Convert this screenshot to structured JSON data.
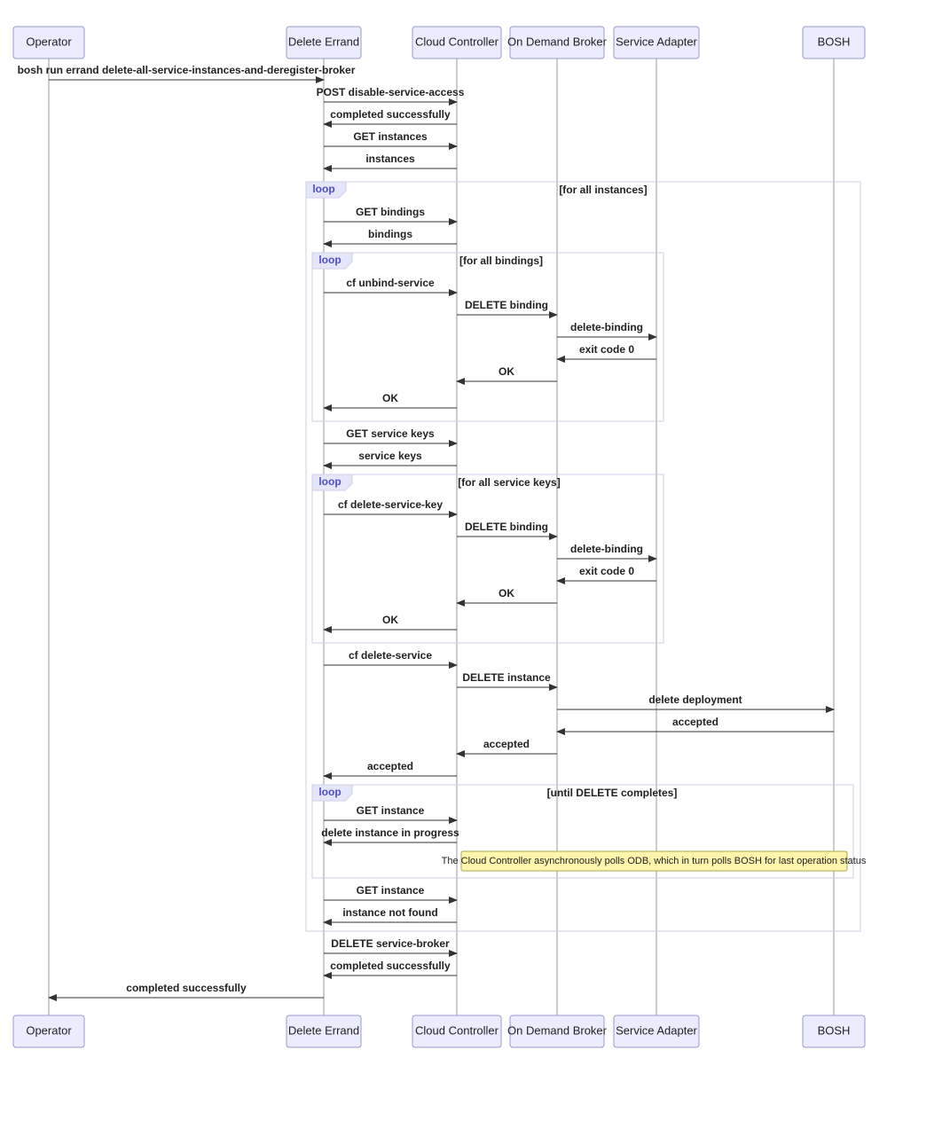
{
  "actors": {
    "operator": "Operator",
    "delete_errand": "Delete Errand",
    "cloud_controller": "Cloud Controller",
    "on_demand_broker": "On Demand Broker",
    "service_adapter": "Service Adapter",
    "bosh": "BOSH"
  },
  "loop_label": "loop",
  "conditions": {
    "all_instances": "[for all instances]",
    "all_bindings": "[for all bindings]",
    "all_service_keys": "[for all service keys]",
    "until_delete": "[until DELETE completes]"
  },
  "messages": {
    "m1": "bosh run errand delete-all-service-instances-and-deregister-broker",
    "m2": "POST disable-service-access",
    "m3": "completed successfully",
    "m4": "GET instances",
    "m5": "instances",
    "m6": "GET bindings",
    "m7": "bindings",
    "m8": "cf unbind-service",
    "m9": "DELETE binding",
    "m10": "delete-binding",
    "m11": "exit code 0",
    "m12": "OK",
    "m13": "OK",
    "m14": "GET service keys",
    "m15": "service keys",
    "m16": "cf delete-service-key",
    "m17": "DELETE binding",
    "m18": "delete-binding",
    "m19": "exit code 0",
    "m20": "OK",
    "m21": "OK",
    "m22": "cf delete-service",
    "m23": "DELETE instance",
    "m24": "delete deployment",
    "m25": "accepted",
    "m26": "accepted",
    "m27": "accepted",
    "m28": "GET instance",
    "m29": "delete instance in progress",
    "m30": "GET instance",
    "m31": "instance not found",
    "m32": "DELETE service-broker",
    "m33": "completed successfully",
    "m34": "completed successfully"
  },
  "note": "The Cloud Controller asynchronously polls ODB, which in turn polls BOSH for last operation status"
}
